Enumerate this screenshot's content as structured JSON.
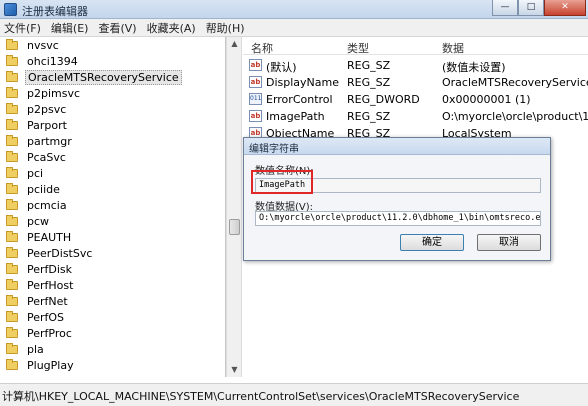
{
  "window": {
    "title": "注册表编辑器",
    "buttons": {
      "minimize": "—",
      "maximize": "□",
      "close": "✕"
    }
  },
  "menu": [
    "文件(F)",
    "编辑(E)",
    "查看(V)",
    "收藏夹(A)",
    "帮助(H)"
  ],
  "tree": {
    "items": [
      "nvsvc",
      "ohci1394",
      "OracleMTSRecoveryService",
      "p2pimsvc",
      "p2psvc",
      "Parport",
      "partmgr",
      "PcaSvc",
      "pci",
      "pciide",
      "pcmcia",
      "pcw",
      "PEAUTH",
      "PeerDistSvc",
      "PerfDisk",
      "PerfHost",
      "PerfNet",
      "PerfOS",
      "PerfProc",
      "pla",
      "PlugPlay"
    ],
    "selected_index": 2
  },
  "values": {
    "headers": {
      "name": "名称",
      "type": "类型",
      "data": "数据"
    },
    "rows": [
      {
        "icon": "ab",
        "name": "(默认)",
        "type": "REG_SZ",
        "data": "(数值未设置)"
      },
      {
        "icon": "ab",
        "name": "DisplayName",
        "type": "REG_SZ",
        "data": "OracleMTSRecoveryService"
      },
      {
        "icon": "bin",
        "name": "ErrorControl",
        "type": "REG_DWORD",
        "data": "0x00000001 (1)"
      },
      {
        "icon": "ab",
        "name": "ImagePath",
        "type": "REG_SZ",
        "data": "O:\\myorcle\\orcle\\product\\11.2.0"
      },
      {
        "icon": "ab",
        "name": "ObjectName",
        "type": "REG_SZ",
        "data": "LocalSystem"
      }
    ]
  },
  "dialog": {
    "title": "编辑字符串",
    "name_label": "数值名称(N):",
    "name_value": "ImagePath",
    "data_label": "数值数据(V):",
    "data_value": "O:\\myorcle\\orcle\\product\\11.2.0\\dbhome_1\\bin\\omtsreco.exe \"",
    "ok": "确定",
    "cancel": "取消"
  },
  "status": {
    "path": "计算机\\HKEY_LOCAL_MACHINE\\SYSTEM\\CurrentControlSet\\services\\OracleMTSRecoveryService"
  },
  "colors": {
    "highlight": "#e02727"
  }
}
